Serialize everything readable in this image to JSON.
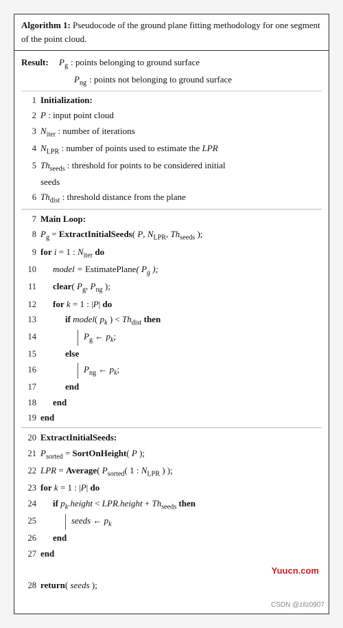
{
  "algorithm": {
    "title_label": "Algorithm 1:",
    "title_text": " Pseudocode of the ground plane fitting methodology for one segment of the point cloud.",
    "result_label": "Result:",
    "result_pg_text": "P",
    "result_pg_sub": "g",
    "result_pg_desc": ": points belonging to ground surface",
    "result_png_text": "P",
    "result_png_sub": "ng",
    "result_png_desc": ": points not belonging to ground surface",
    "lines": [
      {
        "num": "1",
        "content": "Initialization:",
        "bold": true,
        "indent": 0
      },
      {
        "num": "2",
        "content": "P : input point cloud",
        "indent": 0
      },
      {
        "num": "3",
        "content": "N_iter : number of iterations",
        "indent": 0
      },
      {
        "num": "4",
        "content": "N_LPR : number of points used to estimate the LPR",
        "indent": 0
      },
      {
        "num": "5",
        "content": "Th_seeds : threshold for points to be considered initial seeds",
        "indent": 0
      },
      {
        "num": "6",
        "content": "Th_dist : threshold distance from the plane",
        "indent": 0
      },
      {
        "num": "7",
        "content": "Main Loop:",
        "bold": true,
        "indent": 0
      },
      {
        "num": "8",
        "content": "P_g = ExtractInitialSeeds( P, N_LPR, Th_seeds );",
        "indent": 0
      },
      {
        "num": "9",
        "content": "for i = 1 : N_iter do",
        "indent": 0
      },
      {
        "num": "10",
        "content": "model = EstimatePlane( P_g );",
        "indent": 1
      },
      {
        "num": "11",
        "content": "clear( P_g, P_ng );",
        "indent": 1
      },
      {
        "num": "12",
        "content": "for k = 1 : |P| do",
        "indent": 1
      },
      {
        "num": "13",
        "content": "if model( p_k ) < Th_dist then",
        "indent": 2
      },
      {
        "num": "14",
        "content": "P_g ← p_k;",
        "indent": 3,
        "vbar": 1
      },
      {
        "num": "15",
        "content": "else",
        "indent": 2
      },
      {
        "num": "16",
        "content": "P_ng ← p_k;",
        "indent": 3,
        "vbar": 1
      },
      {
        "num": "17",
        "content": "end",
        "indent": 2
      },
      {
        "num": "18",
        "content": "end",
        "indent": 1
      },
      {
        "num": "19",
        "content": "end",
        "indent": 0
      },
      {
        "num": "20",
        "content": "ExtractInitialSeeds:",
        "bold": true,
        "indent": 0
      },
      {
        "num": "21",
        "content": "P_sorted = SortOnHeight( P );",
        "indent": 0
      },
      {
        "num": "22",
        "content": "LPR = Average( P_sorted( 1 : N_LPR ) );",
        "indent": 0
      },
      {
        "num": "23",
        "content": "for k = 1 : |P| do",
        "indent": 0
      },
      {
        "num": "24",
        "content": "if p_k.height < LPR.height + Th_seeds then",
        "indent": 1
      },
      {
        "num": "25",
        "content": "seeds ← p_k",
        "indent": 2,
        "vbar": 1
      },
      {
        "num": "26",
        "content": "end",
        "indent": 1
      },
      {
        "num": "27",
        "content": "end",
        "indent": 0
      },
      {
        "num": "28",
        "content": "return( seeds );",
        "indent": 0
      }
    ],
    "watermark": "Yuucn.com",
    "footer": "CSDN @zilz0907"
  }
}
